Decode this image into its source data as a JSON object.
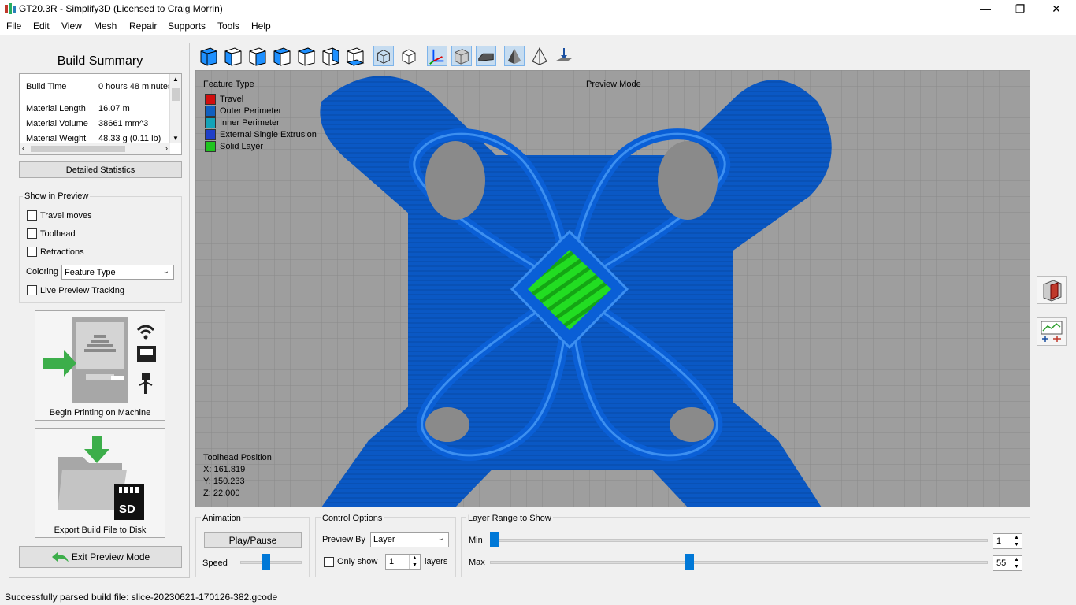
{
  "window": {
    "title": "GT20.3R - Simplify3D (Licensed to Craig Morrin)",
    "minimize": "—",
    "restore": "❐",
    "close": "✕"
  },
  "menu": [
    "File",
    "Edit",
    "View",
    "Mesh",
    "Repair",
    "Supports",
    "Tools",
    "Help"
  ],
  "build_summary": {
    "title": "Build Summary",
    "stats": [
      {
        "label": "Build Time",
        "value": "0 hours 48 minutes"
      },
      {
        "label": "Material Length",
        "value": "16.07 m"
      },
      {
        "label": "Material Volume",
        "value": "38661 mm^3"
      },
      {
        "label": "Material Weight",
        "value": "48.33 g (0.11 lb)"
      }
    ],
    "detailed_stats_button": "Detailed Statistics"
  },
  "show_in_preview": {
    "title": "Show in Preview",
    "travel_moves": "Travel moves",
    "toolhead": "Toolhead",
    "retractions": "Retractions",
    "coloring_label": "Coloring",
    "coloring_value": "Feature Type",
    "live_preview": "Live Preview Tracking"
  },
  "tiles": {
    "begin_printing": "Begin Printing on Machine",
    "export": "Export Build File to Disk",
    "sd_label": "SD"
  },
  "exit_preview": "Exit Preview Mode",
  "viewport": {
    "legend_title": "Feature Type",
    "legend": [
      {
        "label": "Travel",
        "color": "#d10e0e"
      },
      {
        "label": "Outer Perimeter",
        "color": "#0f5fbf"
      },
      {
        "label": "Inner Perimeter",
        "color": "#14a3b8"
      },
      {
        "label": "External Single Extrusion",
        "color": "#1f3fc8"
      },
      {
        "label": "Solid Layer",
        "color": "#1ec41e"
      }
    ],
    "mode": "Preview Mode",
    "toolhead_title": "Toolhead Position",
    "toolhead_x": "X: 161.819",
    "toolhead_y": "Y: 150.233",
    "toolhead_z": "Z: 22.000"
  },
  "animation": {
    "title": "Animation",
    "play_pause": "Play/Pause",
    "speed_label": "Speed",
    "speed_fraction": 0.4
  },
  "control_options": {
    "title": "Control Options",
    "preview_by_label": "Preview By",
    "preview_by_value": "Layer",
    "only_show_label": "Only show",
    "only_show_value": "1",
    "layers_label": "layers"
  },
  "layer_range": {
    "title": "Layer Range to Show",
    "min_label": "Min",
    "min_value": "1",
    "max_label": "Max",
    "max_value": "55",
    "min_fraction": 0.0,
    "max_fraction": 0.4
  },
  "status": "Successfully parsed build file: slice-20230621-170126-382.gcode",
  "colors": {
    "accent": "#0078d7",
    "model_blue": "#0a58c4",
    "infill_green": "#22e022",
    "grid_bg": "#9e9e9e"
  }
}
